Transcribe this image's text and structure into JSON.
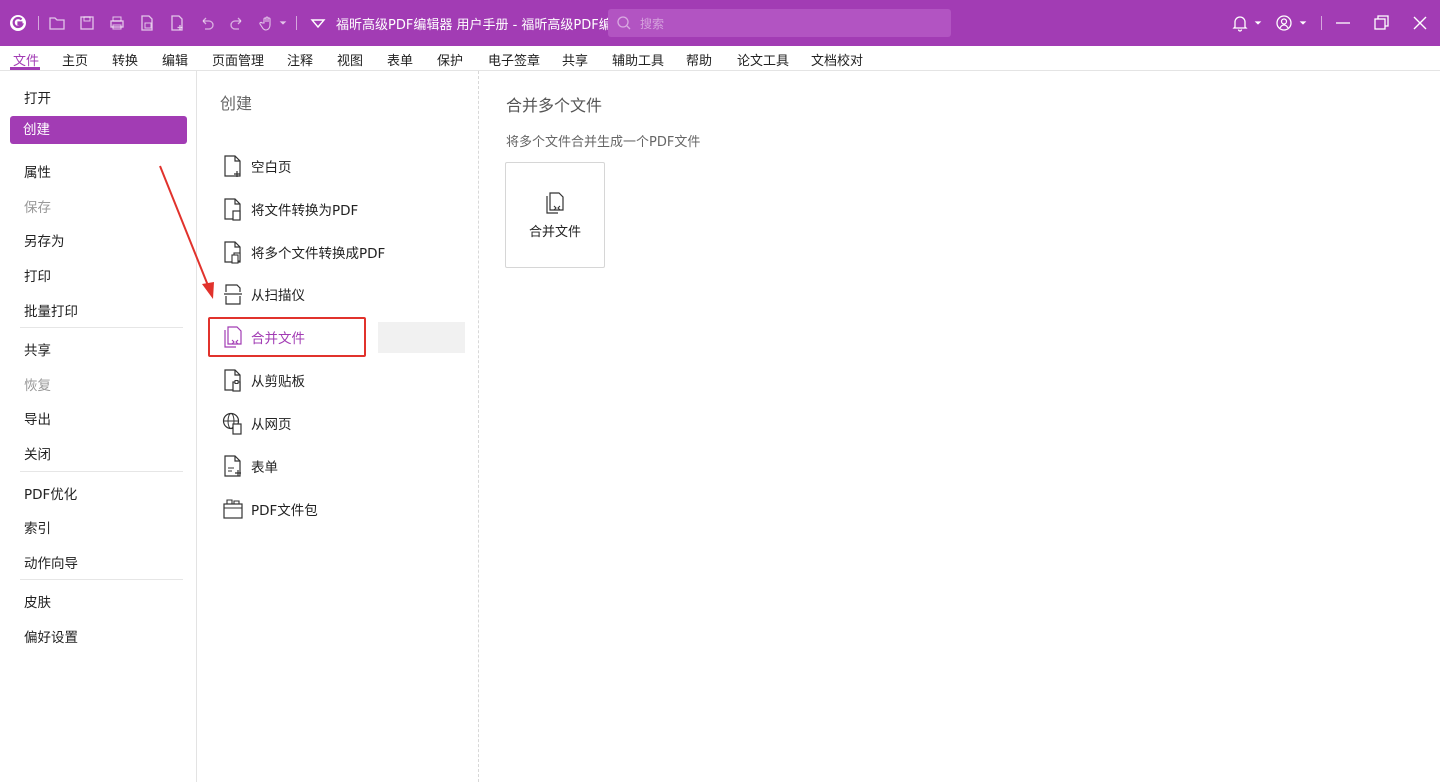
{
  "titlebar": {
    "doc_title": "福昕高级PDF编辑器 用户手册 - 福昕高级PDF编辑...",
    "search_placeholder": "搜索",
    "bg_color": "#a23cb4"
  },
  "menubar": {
    "items": [
      "文件",
      "主页",
      "转换",
      "编辑",
      "页面管理",
      "注释",
      "视图",
      "表单",
      "保护",
      "电子签章",
      "共享",
      "辅助工具",
      "帮助",
      "论文工具",
      "文档校对"
    ],
    "active_index": 0
  },
  "left_panel": {
    "items": {
      "open": "打开",
      "create": "创建",
      "properties": "属性",
      "save": "保存",
      "save_as": "另存为",
      "print": "打印",
      "batch_print": "批量打印",
      "share": "共享",
      "restore": "恢复",
      "export": "导出",
      "close": "关闭",
      "pdf_optimize": "PDF优化",
      "index": "索引",
      "action_wizard": "动作向导",
      "skin": "皮肤",
      "preferences": "偏好设置"
    }
  },
  "create_panel": {
    "heading": "创建",
    "items": {
      "blank_page": "空白页",
      "convert_file": "将文件转换为PDF",
      "convert_multiple": "将多个文件转换成PDF",
      "from_scanner": "从扫描仪",
      "combine_files": "合并文件",
      "from_clipboard": "从剪贴板",
      "from_webpage": "从网页",
      "form": "表单",
      "pdf_portfolio": "PDF文件包"
    }
  },
  "detail": {
    "title": "合并多个文件",
    "description": "将多个文件合并生成一个PDF文件",
    "card_label": "合并文件"
  },
  "colors": {
    "accent": "#a23cb4",
    "highlight": "#e1322c"
  }
}
